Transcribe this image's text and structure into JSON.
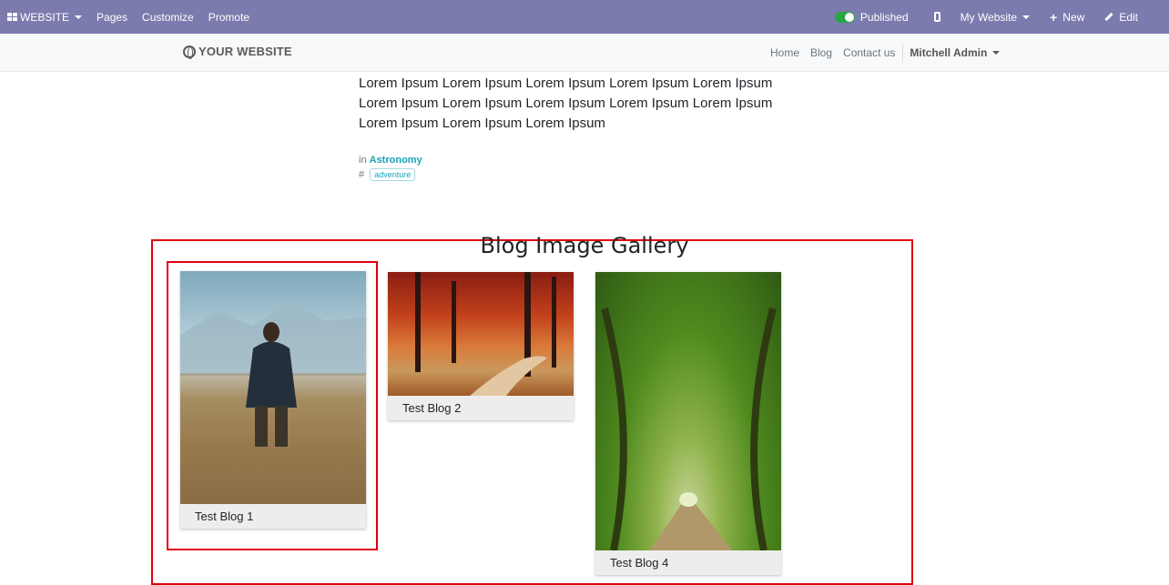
{
  "admin_bar": {
    "website_menu": "WEBSITE",
    "pages": "Pages",
    "customize": "Customize",
    "promote": "Promote",
    "published": "Published",
    "my_website": "My Website",
    "new": "New",
    "edit": "Edit"
  },
  "header": {
    "logo": "YOUR WEBSITE",
    "nav": [
      "Home",
      "Blog",
      "Contact us"
    ],
    "user": "Mitchell Admin"
  },
  "post": {
    "body": "Lorem Ipsum Lorem Ipsum Lorem Ipsum Lorem Ipsum Lorem Ipsum Lorem Ipsum Lorem Ipsum Lorem Ipsum Lorem Ipsum Lorem Ipsum Lorem Ipsum Lorem Ipsum Lorem Ipsum",
    "in_label": "in",
    "category": "Astronomy",
    "hash": "#",
    "tag": "adventure"
  },
  "gallery": {
    "title": "Blog Image Gallery",
    "cards": [
      {
        "caption": "Test Blog 1"
      },
      {
        "caption": "Test Blog 2"
      },
      {
        "caption": "Test Blog 4"
      }
    ]
  },
  "colors": {
    "admin_bar": "#7c7bad",
    "highlight": "#e0000f",
    "link": "#17a2b8"
  }
}
